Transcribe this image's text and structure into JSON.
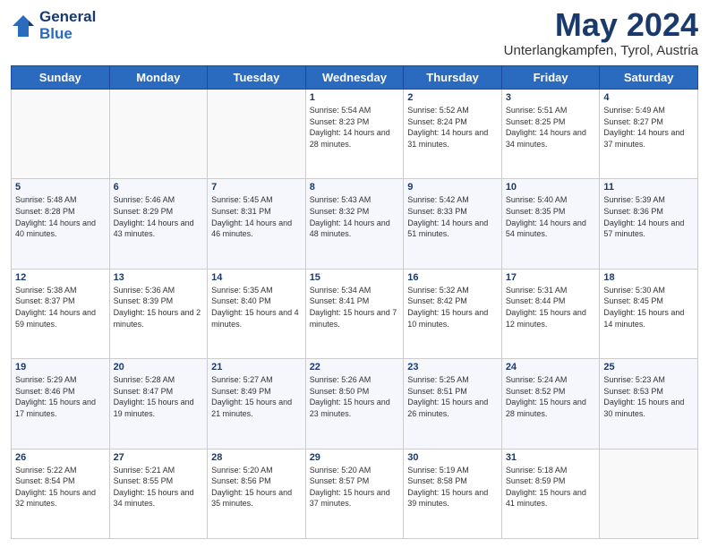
{
  "header": {
    "logo_line1": "General",
    "logo_line2": "Blue",
    "month": "May 2024",
    "location": "Unterlangkampfen, Tyrol, Austria"
  },
  "days_of_week": [
    "Sunday",
    "Monday",
    "Tuesday",
    "Wednesday",
    "Thursday",
    "Friday",
    "Saturday"
  ],
  "weeks": [
    [
      {
        "day": "",
        "sunrise": "",
        "sunset": "",
        "daylight": ""
      },
      {
        "day": "",
        "sunrise": "",
        "sunset": "",
        "daylight": ""
      },
      {
        "day": "",
        "sunrise": "",
        "sunset": "",
        "daylight": ""
      },
      {
        "day": "1",
        "sunrise": "Sunrise: 5:54 AM",
        "sunset": "Sunset: 8:23 PM",
        "daylight": "Daylight: 14 hours and 28 minutes."
      },
      {
        "day": "2",
        "sunrise": "Sunrise: 5:52 AM",
        "sunset": "Sunset: 8:24 PM",
        "daylight": "Daylight: 14 hours and 31 minutes."
      },
      {
        "day": "3",
        "sunrise": "Sunrise: 5:51 AM",
        "sunset": "Sunset: 8:25 PM",
        "daylight": "Daylight: 14 hours and 34 minutes."
      },
      {
        "day": "4",
        "sunrise": "Sunrise: 5:49 AM",
        "sunset": "Sunset: 8:27 PM",
        "daylight": "Daylight: 14 hours and 37 minutes."
      }
    ],
    [
      {
        "day": "5",
        "sunrise": "Sunrise: 5:48 AM",
        "sunset": "Sunset: 8:28 PM",
        "daylight": "Daylight: 14 hours and 40 minutes."
      },
      {
        "day": "6",
        "sunrise": "Sunrise: 5:46 AM",
        "sunset": "Sunset: 8:29 PM",
        "daylight": "Daylight: 14 hours and 43 minutes."
      },
      {
        "day": "7",
        "sunrise": "Sunrise: 5:45 AM",
        "sunset": "Sunset: 8:31 PM",
        "daylight": "Daylight: 14 hours and 46 minutes."
      },
      {
        "day": "8",
        "sunrise": "Sunrise: 5:43 AM",
        "sunset": "Sunset: 8:32 PM",
        "daylight": "Daylight: 14 hours and 48 minutes."
      },
      {
        "day": "9",
        "sunrise": "Sunrise: 5:42 AM",
        "sunset": "Sunset: 8:33 PM",
        "daylight": "Daylight: 14 hours and 51 minutes."
      },
      {
        "day": "10",
        "sunrise": "Sunrise: 5:40 AM",
        "sunset": "Sunset: 8:35 PM",
        "daylight": "Daylight: 14 hours and 54 minutes."
      },
      {
        "day": "11",
        "sunrise": "Sunrise: 5:39 AM",
        "sunset": "Sunset: 8:36 PM",
        "daylight": "Daylight: 14 hours and 57 minutes."
      }
    ],
    [
      {
        "day": "12",
        "sunrise": "Sunrise: 5:38 AM",
        "sunset": "Sunset: 8:37 PM",
        "daylight": "Daylight: 14 hours and 59 minutes."
      },
      {
        "day": "13",
        "sunrise": "Sunrise: 5:36 AM",
        "sunset": "Sunset: 8:39 PM",
        "daylight": "Daylight: 15 hours and 2 minutes."
      },
      {
        "day": "14",
        "sunrise": "Sunrise: 5:35 AM",
        "sunset": "Sunset: 8:40 PM",
        "daylight": "Daylight: 15 hours and 4 minutes."
      },
      {
        "day": "15",
        "sunrise": "Sunrise: 5:34 AM",
        "sunset": "Sunset: 8:41 PM",
        "daylight": "Daylight: 15 hours and 7 minutes."
      },
      {
        "day": "16",
        "sunrise": "Sunrise: 5:32 AM",
        "sunset": "Sunset: 8:42 PM",
        "daylight": "Daylight: 15 hours and 10 minutes."
      },
      {
        "day": "17",
        "sunrise": "Sunrise: 5:31 AM",
        "sunset": "Sunset: 8:44 PM",
        "daylight": "Daylight: 15 hours and 12 minutes."
      },
      {
        "day": "18",
        "sunrise": "Sunrise: 5:30 AM",
        "sunset": "Sunset: 8:45 PM",
        "daylight": "Daylight: 15 hours and 14 minutes."
      }
    ],
    [
      {
        "day": "19",
        "sunrise": "Sunrise: 5:29 AM",
        "sunset": "Sunset: 8:46 PM",
        "daylight": "Daylight: 15 hours and 17 minutes."
      },
      {
        "day": "20",
        "sunrise": "Sunrise: 5:28 AM",
        "sunset": "Sunset: 8:47 PM",
        "daylight": "Daylight: 15 hours and 19 minutes."
      },
      {
        "day": "21",
        "sunrise": "Sunrise: 5:27 AM",
        "sunset": "Sunset: 8:49 PM",
        "daylight": "Daylight: 15 hours and 21 minutes."
      },
      {
        "day": "22",
        "sunrise": "Sunrise: 5:26 AM",
        "sunset": "Sunset: 8:50 PM",
        "daylight": "Daylight: 15 hours and 23 minutes."
      },
      {
        "day": "23",
        "sunrise": "Sunrise: 5:25 AM",
        "sunset": "Sunset: 8:51 PM",
        "daylight": "Daylight: 15 hours and 26 minutes."
      },
      {
        "day": "24",
        "sunrise": "Sunrise: 5:24 AM",
        "sunset": "Sunset: 8:52 PM",
        "daylight": "Daylight: 15 hours and 28 minutes."
      },
      {
        "day": "25",
        "sunrise": "Sunrise: 5:23 AM",
        "sunset": "Sunset: 8:53 PM",
        "daylight": "Daylight: 15 hours and 30 minutes."
      }
    ],
    [
      {
        "day": "26",
        "sunrise": "Sunrise: 5:22 AM",
        "sunset": "Sunset: 8:54 PM",
        "daylight": "Daylight: 15 hours and 32 minutes."
      },
      {
        "day": "27",
        "sunrise": "Sunrise: 5:21 AM",
        "sunset": "Sunset: 8:55 PM",
        "daylight": "Daylight: 15 hours and 34 minutes."
      },
      {
        "day": "28",
        "sunrise": "Sunrise: 5:20 AM",
        "sunset": "Sunset: 8:56 PM",
        "daylight": "Daylight: 15 hours and 35 minutes."
      },
      {
        "day": "29",
        "sunrise": "Sunrise: 5:20 AM",
        "sunset": "Sunset: 8:57 PM",
        "daylight": "Daylight: 15 hours and 37 minutes."
      },
      {
        "day": "30",
        "sunrise": "Sunrise: 5:19 AM",
        "sunset": "Sunset: 8:58 PM",
        "daylight": "Daylight: 15 hours and 39 minutes."
      },
      {
        "day": "31",
        "sunrise": "Sunrise: 5:18 AM",
        "sunset": "Sunset: 8:59 PM",
        "daylight": "Daylight: 15 hours and 41 minutes."
      },
      {
        "day": "",
        "sunrise": "",
        "sunset": "",
        "daylight": ""
      }
    ]
  ]
}
